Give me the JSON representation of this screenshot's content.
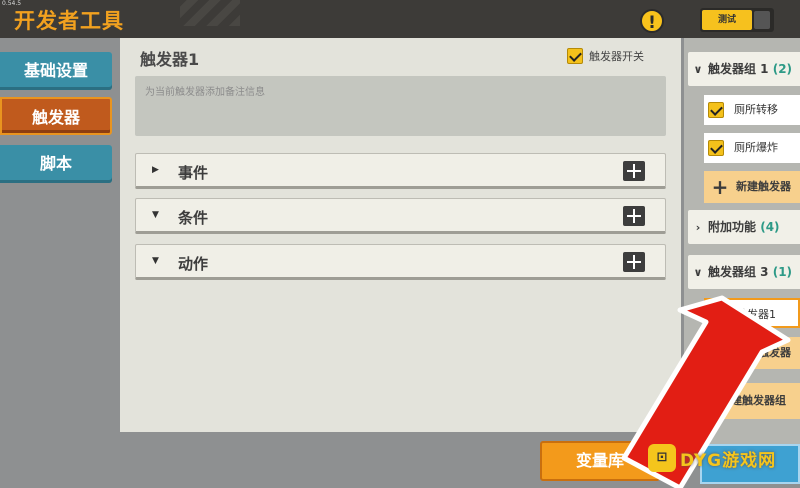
{
  "header": {
    "version": "0.54.5",
    "title": "开发者工具",
    "test_label": "测试"
  },
  "sidebar": {
    "items": [
      {
        "label": "基础设置"
      },
      {
        "label": "触发器"
      },
      {
        "label": "脚本"
      }
    ]
  },
  "main": {
    "title": "触发器1",
    "switch_label": "触发器开关",
    "note_placeholder": "为当前触发器添加备注信息",
    "sections": [
      {
        "label": "事件"
      },
      {
        "label": "条件"
      },
      {
        "label": "动作"
      }
    ]
  },
  "bottom": {
    "variable_button": "变量库"
  },
  "right_panel": {
    "group1": {
      "label": "触发器组 1",
      "count": "(2)"
    },
    "group1_items": [
      {
        "label": "厕所转移"
      },
      {
        "label": "厕所爆炸"
      }
    ],
    "new_trigger_1": "新建触发器",
    "addon": {
      "label": "附加功能",
      "count": "(4)"
    },
    "group3": {
      "label": "触发器组 3",
      "count": "(1)"
    },
    "group3_items": [
      {
        "label": "触发器1"
      }
    ],
    "new_trigger_2": "新建触发器",
    "new_trigger_group": "新建触发器组"
  },
  "watermark": {
    "text": "DYG游戏网"
  },
  "colors": {
    "accent": "#f39a1b",
    "sidebar_blue": "#3a8fa6",
    "sidebar_active": "#c05a1d",
    "arrow_red": "#e21e14"
  }
}
